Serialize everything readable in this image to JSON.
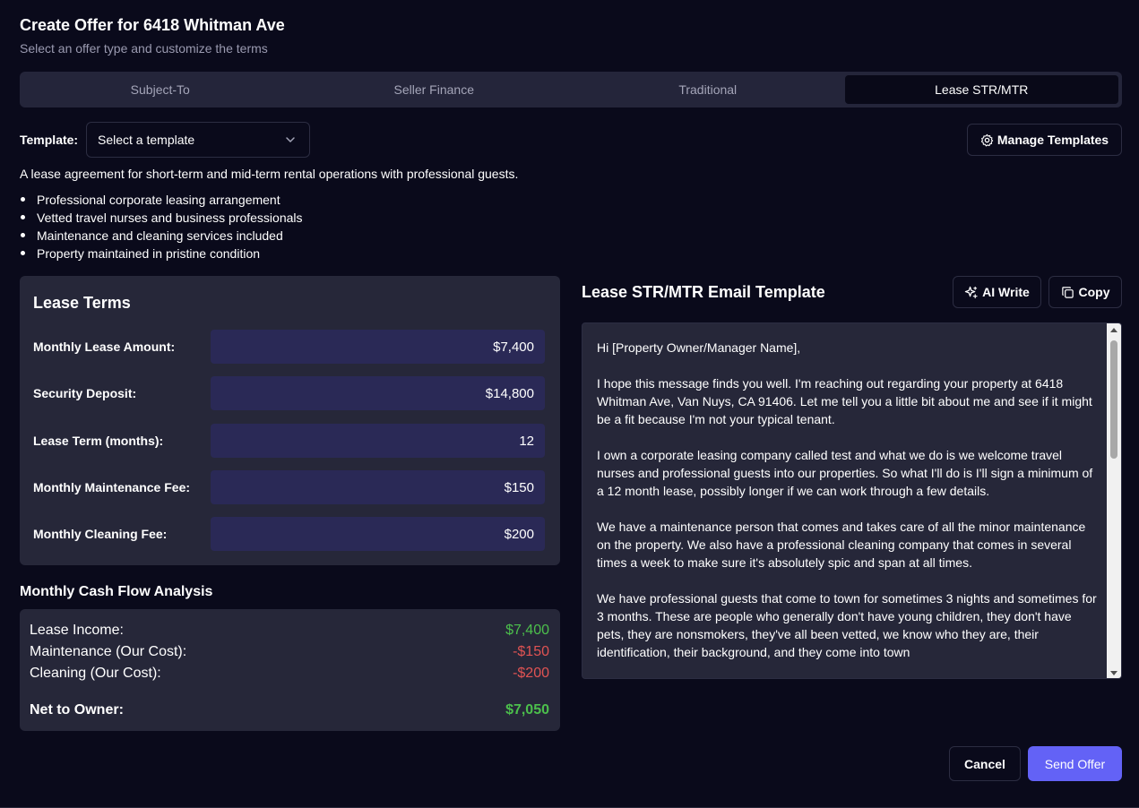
{
  "dialog": {
    "title": "Create Offer for 6418 Whitman Ave",
    "subtitle": "Select an offer type and customize the terms"
  },
  "tabs": [
    {
      "label": "Subject-To",
      "active": false
    },
    {
      "label": "Seller Finance",
      "active": false
    },
    {
      "label": "Traditional",
      "active": false
    },
    {
      "label": "Lease STR/MTR",
      "active": true
    }
  ],
  "template": {
    "label": "Template:",
    "placeholder": "Select a template",
    "manage_label": "Manage Templates"
  },
  "description": "A lease agreement for short-term and mid-term rental operations with professional guests.",
  "bullets": [
    "Professional corporate leasing arrangement",
    "Vetted travel nurses and business professionals",
    "Maintenance and cleaning services included",
    "Property maintained in pristine condition"
  ],
  "lease_terms": {
    "title": "Lease Terms",
    "fields": [
      {
        "label": "Monthly Lease Amount:",
        "value": "$7,400"
      },
      {
        "label": "Security Deposit:",
        "value": "$14,800"
      },
      {
        "label": "Lease Term (months):",
        "value": "12"
      },
      {
        "label": "Monthly Maintenance Fee:",
        "value": "$150"
      },
      {
        "label": "Monthly Cleaning Fee:",
        "value": "$200"
      }
    ]
  },
  "cash_flow": {
    "title": "Monthly Cash Flow Analysis",
    "rows": [
      {
        "label": "Lease Income:",
        "value": "$7,400"
      },
      {
        "label": "Maintenance (Our Cost):",
        "value": "-$150"
      },
      {
        "label": "Cleaning (Our Cost):",
        "value": "-$200"
      }
    ],
    "net_label": "Net to Owner:",
    "net_value": "$7,050",
    "colors": {
      "positive": "#4cbf4c",
      "negative": "#e05353"
    }
  },
  "email": {
    "title": "Lease STR/MTR Email Template",
    "ai_write_label": "AI Write",
    "copy_label": "Copy",
    "body": "Hi [Property Owner/Manager Name],\n\nI hope this message finds you well. I'm reaching out regarding your property at 6418 Whitman Ave, Van Nuys, CA 91406. Let me tell you a little bit about me and see if it might be a fit because I'm not your typical tenant.\n\nI own a corporate leasing company called test and what we do is we welcome travel nurses and professional guests into our properties. So what I'll do is I'll sign a minimum of a 12 month lease, possibly longer if we can work through a few details.\n\nWe have a maintenance person that comes and takes care of all the minor maintenance on the property. We also have a professional cleaning company that comes in several times a week to make sure it's absolutely spic and span at all times.\n\nWe have professional guests that come to town for sometimes 3 nights and sometimes for 3 months. These are people who generally don't have young children, they don't have pets, they are nonsmokers, they've all been vetted, we know who they are, their identification, their background, and they come into town"
  },
  "actions": {
    "cancel_label": "Cancel",
    "send_label": "Send Offer",
    "accent_color": "#6362f6"
  },
  "icons": {
    "select": "chevron-down-icon",
    "manage": "gear-icon",
    "ai_write": "sparkles-icon",
    "copy": "copy-icon"
  }
}
